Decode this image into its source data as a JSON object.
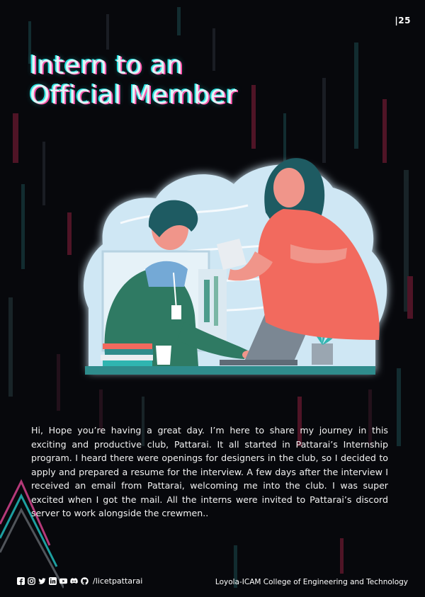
{
  "page_number": "|25",
  "title": {
    "line1": "Intern to an",
    "line2": "Official Member"
  },
  "body_text": "Hi, Hope you’re having a great day. I’m here to share my journey in this exciting and productive club, Pattarai. It all started in Pattarai’s Internship program. I heard there were openings for designers in the club, so I decided to apply and prepared a resume for the interview. A few days after the interview I received an email from Pattarai, welcoming me into the club. I was super excited when I got the mail. All the interns were invited to Pattarai’s discord server to work alongside the crewmen..",
  "footer": {
    "social_icons": [
      "facebook-icon",
      "instagram-icon",
      "twitter-icon",
      "linkedin-icon",
      "youtube-icon",
      "discord-icon",
      "github-icon"
    ],
    "handle": "/licetpattarai",
    "institution": "Loyola-ICAM College of Engineering and Technology"
  },
  "colors": {
    "background": "#07080c",
    "title_text": "#dff5f5",
    "glitch_pink": "#ff4fa8",
    "glitch_cyan": "#26e0e0",
    "accent_teal": "#2f8c8c",
    "accent_coral": "#f26a5e"
  }
}
